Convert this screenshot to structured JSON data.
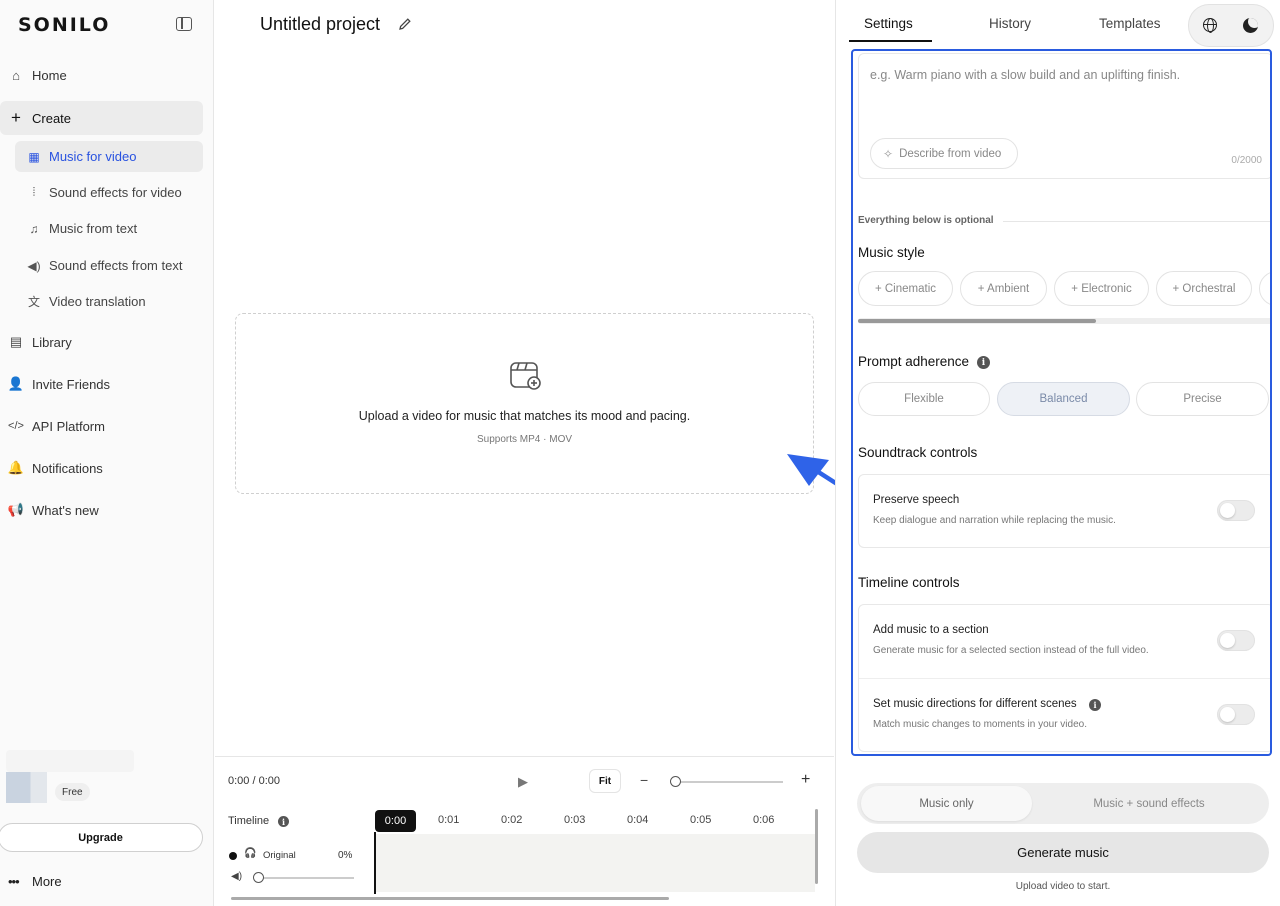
{
  "sidebar": {
    "logo": "SONILO",
    "nav": [
      {
        "label": "Home",
        "icon": "home-icon"
      },
      {
        "label": "Create",
        "icon": "plus-icon"
      },
      {
        "label": "Library",
        "icon": "book-icon"
      },
      {
        "label": "Invite Friends",
        "icon": "user-plus-icon"
      },
      {
        "label": "API Platform",
        "icon": "code-icon"
      },
      {
        "label": "Notifications",
        "icon": "bell-icon"
      },
      {
        "label": "What's new",
        "icon": "megaphone-icon"
      }
    ],
    "create_items": [
      {
        "label": "Music for video",
        "icon": "film-icon"
      },
      {
        "label": "Sound effects for video",
        "icon": "waveform-icon"
      },
      {
        "label": "Music from text",
        "icon": "music-note-icon"
      },
      {
        "label": "Sound effects from text",
        "icon": "speaker-icon"
      },
      {
        "label": "Video translation",
        "icon": "translate-icon"
      }
    ],
    "plan": "Free",
    "upgrade_label": "Upgrade",
    "more_label": "More"
  },
  "main": {
    "project_title": "Untitled project",
    "upload_text": "Upload a video for music that matches its mood and pacing.",
    "upload_sub": "Supports MP4 · MOV",
    "player": {
      "time": "0:00 / 0:00",
      "fit_label": "Fit",
      "timeline_label": "Timeline",
      "ticks": [
        "0:00",
        "0:01",
        "0:02",
        "0:03",
        "0:04",
        "0:05",
        "0:06"
      ],
      "track_name": "Original",
      "track_pct": "0%",
      "zoom_level": 0,
      "volume_level": 0
    }
  },
  "right": {
    "tabs": [
      "Settings",
      "History",
      "Templates"
    ],
    "active_tab": "Settings",
    "prompt_placeholder": "e.g. Warm piano with a slow build and an uplifting finish.",
    "describe_label": "Describe from video",
    "char_count": "0/2000",
    "optional_label": "Everything below is optional",
    "music_style_title": "Music style",
    "styles": [
      "+ Cinematic",
      "+ Ambient",
      "+ Electronic",
      "+ Orchestral"
    ],
    "adherence_title": "Prompt adherence",
    "adherence_options": [
      "Flexible",
      "Balanced",
      "Precise"
    ],
    "adherence_selected": "Balanced",
    "soundtrack_title": "Soundtrack controls",
    "preserve_title": "Preserve speech",
    "preserve_desc": "Keep dialogue and narration while replacing the music.",
    "timeline_title": "Timeline controls",
    "section_title": "Add music to a section",
    "section_desc": "Generate music for a selected section instead of the full video.",
    "directions_title": "Set music directions for different scenes",
    "directions_desc": "Match music changes to moments in your video.",
    "modes": [
      "Music only",
      "Music + sound effects"
    ],
    "mode_selected": "Music only",
    "generate_label": "Generate music",
    "generate_hint": "Upload video to start."
  },
  "colors": {
    "accent": "#2852e0",
    "highlight_border": "#2a5bdf",
    "annotation_arrow": "#2f63e8"
  }
}
